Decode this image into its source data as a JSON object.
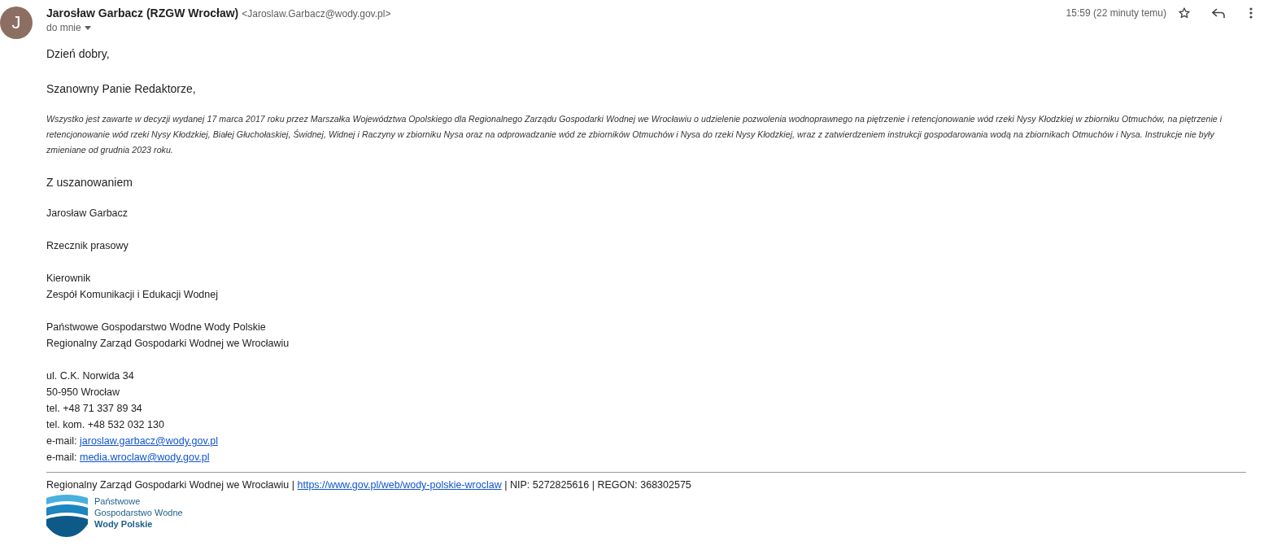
{
  "header": {
    "avatar_letter": "J",
    "sender_name": "Jarosław Garbacz (RZGW Wrocław)",
    "sender_email": "<Jaroslaw.Garbacz@wody.gov.pl>",
    "recipient": "do mnie",
    "time": "15:59 (22 minuty temu)"
  },
  "body": {
    "greeting": "Dzień dobry,",
    "salutation": "Szanowny Panie Redaktorze,",
    "paragraph": "Wszystko jest zawarte w decyzji wydanej 17 marca 2017 roku przez Marszałka Województwa Opolskiego dla Regionalnego Zarządu Gospodarki Wodnej we Wrocławiu o udzielenie pozwolenia wodnoprawnego na piętrzenie i retencjonowanie wód rzeki Nysy Kłodzkiej w zbiorniku Otmuchów, na piętrzenie i retencjonowanie wód rzeki Nysy Kłodzkiej, Białej Głuchołaskiej, Świdnej, Widnej i Raczyny w zbiorniku Nysa oraz na odprowadzanie wód ze zbiorników Otmuchów i Nysa do rzeki Nysy Kłodzkiej, wraz z zatwierdzeniem instrukcji gospodarowania wodą na zbiornikach Otmuchów i Nysa. Instrukcje nie były zmieniane od grudnia 2023 roku.",
    "closing": "Z uszanowaniem"
  },
  "signature": [
    [
      {
        "kind": "text",
        "text": "Jarosław Garbacz"
      }
    ],
    [
      {
        "kind": "text",
        "text": "Rzecznik prasowy"
      }
    ],
    [
      {
        "kind": "text",
        "text": "Kierownik"
      },
      {
        "kind": "text",
        "text": "Zespół Komunikacji i Edukacji Wodnej"
      }
    ],
    [
      {
        "kind": "text",
        "text": "Państwowe Gospodarstwo Wodne Wody Polskie"
      },
      {
        "kind": "text",
        "text": "Regionalny Zarząd Gospodarki Wodnej we Wrocławiu"
      }
    ],
    [
      {
        "kind": "text",
        "text": "ul. C.K. Norwida 34"
      },
      {
        "kind": "text",
        "text": "50-950 Wrocław"
      },
      {
        "kind": "text",
        "text": "tel. +48 71 337 89 34"
      },
      {
        "kind": "text",
        "text": "tel. kom. +48 532 032 130"
      },
      {
        "kind": "email",
        "label": "e-mail:",
        "link": "jaroslaw.garbacz@wody.gov.pl"
      },
      {
        "kind": "email",
        "label": "e-mail:",
        "link": "media.wroclaw@wody.gov.pl"
      }
    ]
  ],
  "footer": {
    "text_before": "Regionalny Zarząd Gospodarki Wodnej we Wrocławiu |",
    "link": "https://www.gov.pl/web/wody-polskie-wroclaw",
    "text_after": "| NIP: 5272825616 | REGON: 368302575",
    "logo_lines": [
      "Państwowe",
      "Gospodarstwo Wodne",
      "Wody Polskie"
    ]
  }
}
